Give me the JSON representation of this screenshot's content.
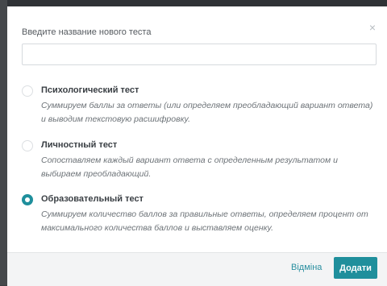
{
  "modal": {
    "label": "Введите название нового теста",
    "close_symbol": "×",
    "input_value": ""
  },
  "options": [
    {
      "title": "Психологический тест",
      "description": "Суммируем баллы за ответы (или определяем преобладающий вариант ответа) и выводим текстовую расшифровку.",
      "checked": false
    },
    {
      "title": "Личностный тест",
      "description": "Сопоставляем каждый вариант ответа с определенным результатом и выбираем преобладающий.",
      "checked": false
    },
    {
      "title": "Образовательный тест",
      "description": "Суммируем количество баллов за правильные ответы, определяем процент от максимального количества баллов и выставляем оценку.",
      "checked": true
    }
  ],
  "footer": {
    "cancel_label": "Відміна",
    "add_label": "Додати"
  },
  "colors": {
    "accent": "#1f8f9c",
    "link": "#2a8fa0"
  }
}
